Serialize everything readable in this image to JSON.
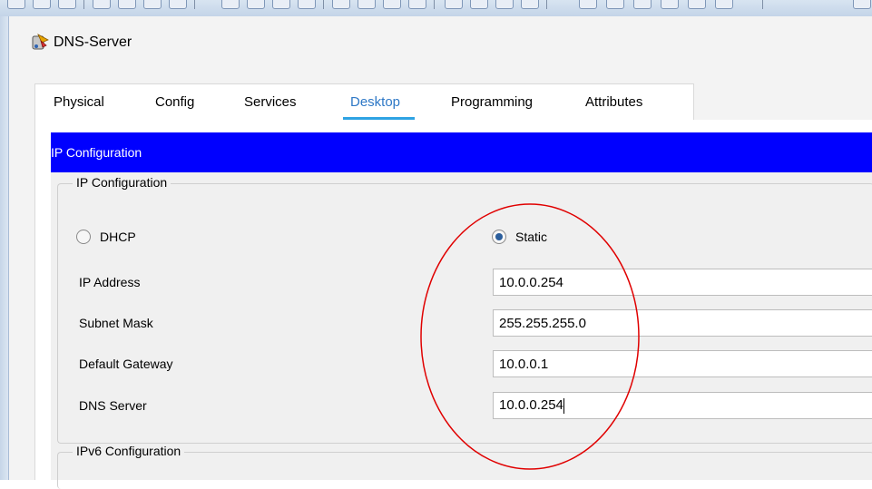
{
  "window": {
    "title": "DNS-Server"
  },
  "tabs": [
    {
      "label": "Physical"
    },
    {
      "label": "Config"
    },
    {
      "label": "Services"
    },
    {
      "label": "Desktop",
      "active": true
    },
    {
      "label": "Programming"
    },
    {
      "label": "Attributes"
    }
  ],
  "panel": {
    "header": "IP Configuration",
    "ipv4_group_label": "IP Configuration",
    "ipv6_group_label": "IPv6 Configuration",
    "mode": {
      "dhcp_label": "DHCP",
      "static_label": "Static",
      "selected": "Static"
    },
    "fields": {
      "ip_address": {
        "label": "IP Address",
        "value": "10.0.0.254"
      },
      "subnet_mask": {
        "label": "Subnet Mask",
        "value": "255.255.255.0"
      },
      "default_gateway": {
        "label": "Default Gateway",
        "value": "10.0.0.1"
      },
      "dns_server": {
        "label": "DNS Server",
        "value": "10.0.0.254"
      }
    }
  },
  "colors": {
    "header_bg": "#0000ff",
    "active_tab_text": "#2e78c6",
    "active_tab_underline": "#2ea3e3",
    "annotation_circle": "#e00000"
  },
  "icons": {
    "app_icon": "pt-server-icon",
    "annotation": "red-ellipse-highlight"
  }
}
